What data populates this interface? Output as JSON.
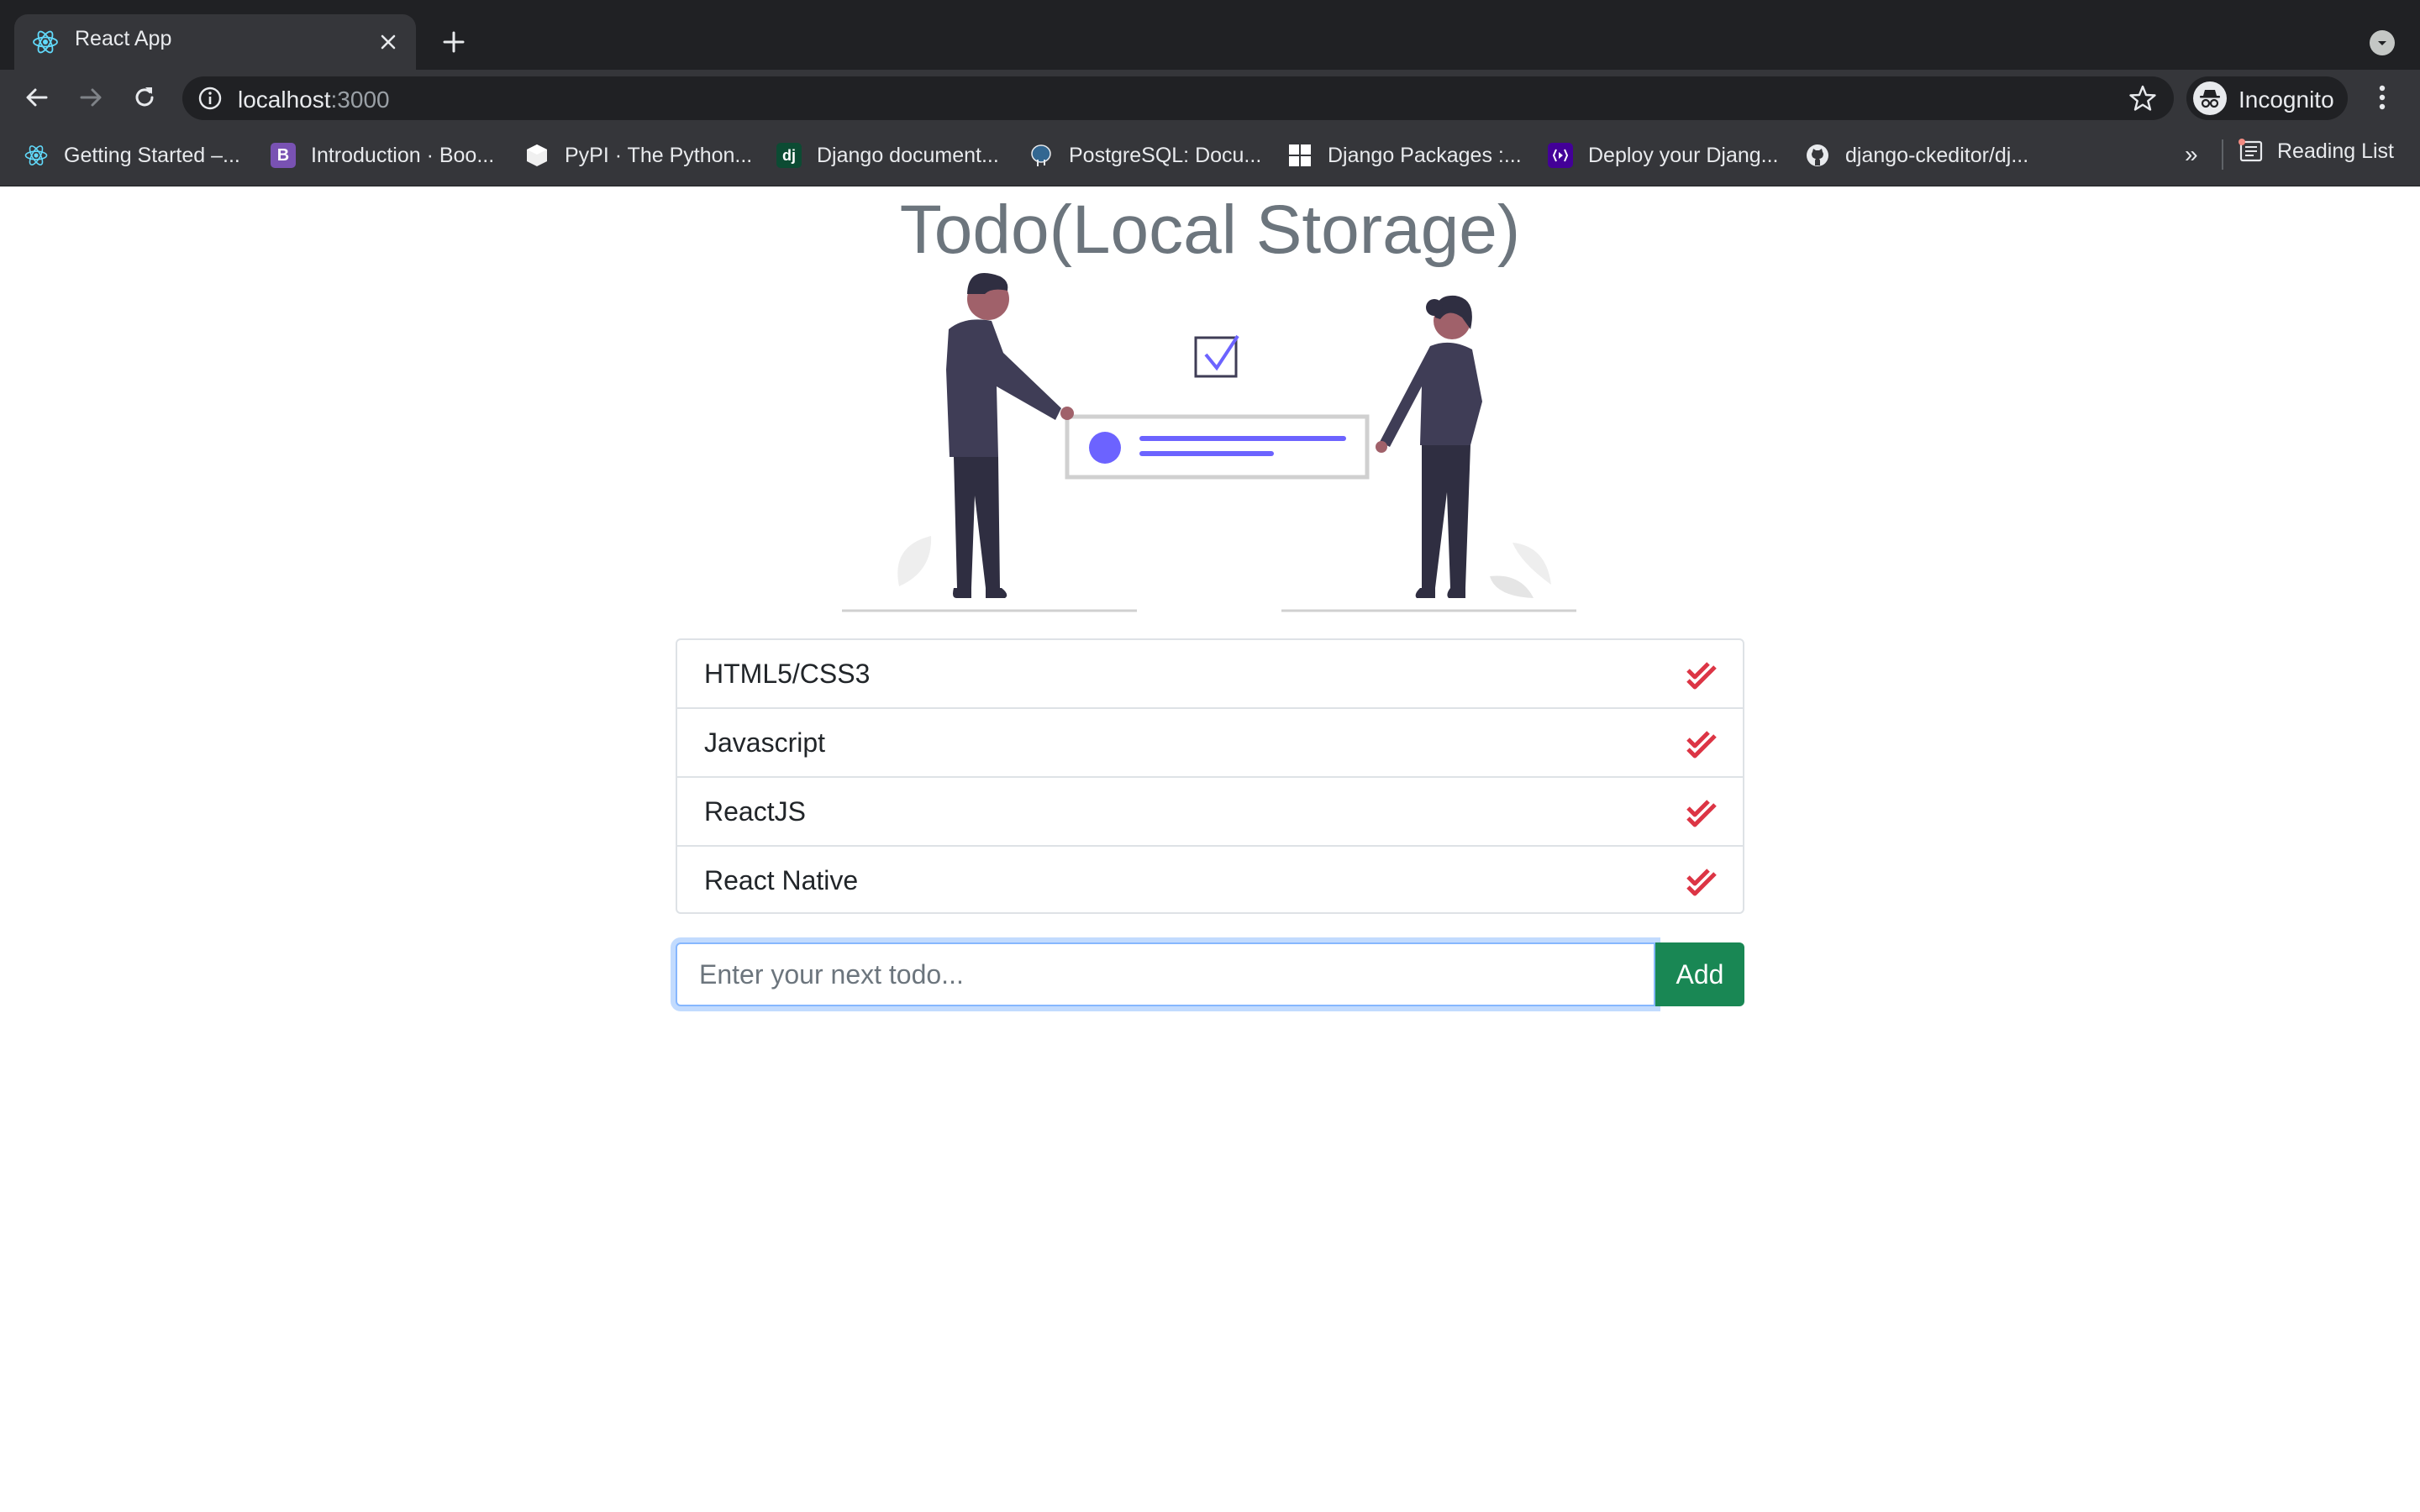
{
  "browser": {
    "tab_title": "React App",
    "url_host": "localhost",
    "url_port": ":3000",
    "profile_label": "Incognito",
    "bookmarks": [
      {
        "label": "Getting Started –...",
        "icon": "react-icon"
      },
      {
        "label": "Introduction · Boo...",
        "icon": "bootstrap-icon",
        "glyph": "B"
      },
      {
        "label": "PyPI · The Python...",
        "icon": "pypi-icon"
      },
      {
        "label": "Django document...",
        "icon": "django-icon",
        "glyph": "dj"
      },
      {
        "label": "PostgreSQL: Docu...",
        "icon": "postgresql-icon"
      },
      {
        "label": "Django Packages :...",
        "icon": "grid-icon"
      },
      {
        "label": "Deploy your Djang...",
        "icon": "heroku-icon"
      },
      {
        "label": "django-ckeditor/dj...",
        "icon": "github-icon"
      }
    ],
    "bookmarks_overflow": "»",
    "reading_list_label": "Reading List"
  },
  "app": {
    "title": "Todo(Local Storage)",
    "todos": [
      {
        "text": "HTML5/CSS3"
      },
      {
        "text": "Javascript"
      },
      {
        "text": "ReactJS"
      },
      {
        "text": "React Native"
      }
    ],
    "input_placeholder": "Enter your next todo...",
    "add_label": "Add"
  },
  "colors": {
    "accent_purple": "#6c63ff",
    "check_red": "#dc3545",
    "add_green": "#198754",
    "title_gray": "#6c757d"
  }
}
